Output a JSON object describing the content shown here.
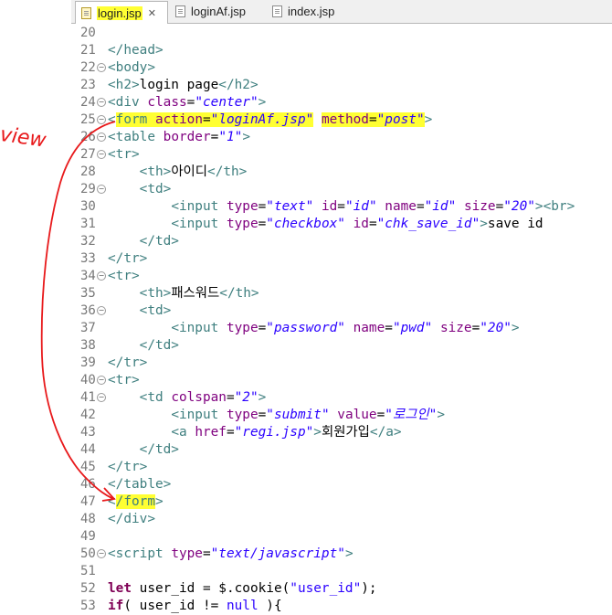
{
  "tabs": [
    {
      "label": "login.jsp",
      "active": true,
      "close": "✕"
    },
    {
      "label": "loginAf.jsp",
      "active": false
    },
    {
      "label": "index.jsp",
      "active": false
    }
  ],
  "annotation": {
    "text": "view",
    "color": "#e8191b"
  },
  "lines": [
    {
      "n": "20",
      "fold": false,
      "parts": []
    },
    {
      "n": "21",
      "fold": false,
      "parts": [
        [
          "tag",
          "</head>"
        ]
      ]
    },
    {
      "n": "22",
      "fold": true,
      "parts": [
        [
          "tag",
          "<body>"
        ]
      ]
    },
    {
      "n": "23",
      "fold": false,
      "parts": [
        [
          "tag",
          "<h2>"
        ],
        [
          "txt",
          "login page"
        ],
        [
          "tag",
          "</h2>"
        ]
      ]
    },
    {
      "n": "24",
      "fold": true,
      "parts": [
        [
          "tag",
          "<div "
        ],
        [
          "attr",
          "class"
        ],
        [
          "txt",
          "="
        ],
        [
          "val",
          "\"center\""
        ],
        [
          "tag",
          ">"
        ]
      ]
    },
    {
      "n": "25",
      "fold": true,
      "parts": [
        [
          "tag",
          "<"
        ],
        [
          "tagh",
          "form "
        ],
        [
          "attrh",
          "action"
        ],
        [
          "txth",
          "="
        ],
        [
          "valh",
          "\"loginAf.jsp\""
        ],
        [
          "txt",
          " "
        ],
        [
          "attrh",
          "method"
        ],
        [
          "txth",
          "="
        ],
        [
          "valh",
          "\"post\""
        ],
        [
          "tag",
          ">"
        ]
      ]
    },
    {
      "n": "26",
      "fold": true,
      "parts": [
        [
          "tag",
          "<table "
        ],
        [
          "attr",
          "border"
        ],
        [
          "txt",
          "="
        ],
        [
          "val",
          "\"1\""
        ],
        [
          "tag",
          ">"
        ]
      ]
    },
    {
      "n": "27",
      "fold": true,
      "parts": [
        [
          "tag",
          "<tr>"
        ]
      ]
    },
    {
      "n": "28",
      "fold": false,
      "parts": [
        [
          "txt",
          "    "
        ],
        [
          "tag",
          "<th>"
        ],
        [
          "txt",
          "아이디"
        ],
        [
          "tag",
          "</th>"
        ]
      ]
    },
    {
      "n": "29",
      "fold": true,
      "parts": [
        [
          "txt",
          "    "
        ],
        [
          "tag",
          "<td>"
        ]
      ]
    },
    {
      "n": "30",
      "fold": false,
      "parts": [
        [
          "txt",
          "        "
        ],
        [
          "tag",
          "<input "
        ],
        [
          "attr",
          "type"
        ],
        [
          "txt",
          "="
        ],
        [
          "val",
          "\"text\""
        ],
        [
          "txt",
          " "
        ],
        [
          "attr",
          "id"
        ],
        [
          "txt",
          "="
        ],
        [
          "val",
          "\"id\""
        ],
        [
          "txt",
          " "
        ],
        [
          "attr",
          "name"
        ],
        [
          "txt",
          "="
        ],
        [
          "val",
          "\"id\""
        ],
        [
          "txt",
          " "
        ],
        [
          "attr",
          "size"
        ],
        [
          "txt",
          "="
        ],
        [
          "val",
          "\"20\""
        ],
        [
          "tag",
          ">"
        ],
        [
          "tag",
          "<br>"
        ]
      ]
    },
    {
      "n": "31",
      "fold": false,
      "parts": [
        [
          "txt",
          "        "
        ],
        [
          "tag",
          "<input "
        ],
        [
          "attr",
          "type"
        ],
        [
          "txt",
          "="
        ],
        [
          "val",
          "\"checkbox\""
        ],
        [
          "txt",
          " "
        ],
        [
          "attr",
          "id"
        ],
        [
          "txt",
          "="
        ],
        [
          "val",
          "\"chk_save_id\""
        ],
        [
          "tag",
          ">"
        ],
        [
          "txt",
          "save id"
        ]
      ]
    },
    {
      "n": "32",
      "fold": false,
      "parts": [
        [
          "txt",
          "    "
        ],
        [
          "tag",
          "</td>"
        ]
      ]
    },
    {
      "n": "33",
      "fold": false,
      "parts": [
        [
          "tag",
          "</tr>"
        ]
      ]
    },
    {
      "n": "34",
      "fold": true,
      "parts": [
        [
          "tag",
          "<tr>"
        ]
      ]
    },
    {
      "n": "35",
      "fold": false,
      "parts": [
        [
          "txt",
          "    "
        ],
        [
          "tag",
          "<th>"
        ],
        [
          "txt",
          "패스워드"
        ],
        [
          "tag",
          "</th>"
        ]
      ]
    },
    {
      "n": "36",
      "fold": true,
      "parts": [
        [
          "txt",
          "    "
        ],
        [
          "tag",
          "<td>"
        ]
      ]
    },
    {
      "n": "37",
      "fold": false,
      "parts": [
        [
          "txt",
          "        "
        ],
        [
          "tag",
          "<input "
        ],
        [
          "attr",
          "type"
        ],
        [
          "txt",
          "="
        ],
        [
          "val",
          "\"password\""
        ],
        [
          "txt",
          " "
        ],
        [
          "attr",
          "name"
        ],
        [
          "txt",
          "="
        ],
        [
          "val",
          "\"pwd\""
        ],
        [
          "txt",
          " "
        ],
        [
          "attr",
          "size"
        ],
        [
          "txt",
          "="
        ],
        [
          "val",
          "\"20\""
        ],
        [
          "tag",
          ">"
        ]
      ]
    },
    {
      "n": "38",
      "fold": false,
      "parts": [
        [
          "txt",
          "    "
        ],
        [
          "tag",
          "</td>"
        ]
      ]
    },
    {
      "n": "39",
      "fold": false,
      "parts": [
        [
          "tag",
          "</tr>"
        ]
      ]
    },
    {
      "n": "40",
      "fold": true,
      "parts": [
        [
          "tag",
          "<tr>"
        ]
      ]
    },
    {
      "n": "41",
      "fold": true,
      "parts": [
        [
          "txt",
          "    "
        ],
        [
          "tag",
          "<td "
        ],
        [
          "attr",
          "colspan"
        ],
        [
          "txt",
          "="
        ],
        [
          "val",
          "\"2\""
        ],
        [
          "tag",
          ">"
        ]
      ]
    },
    {
      "n": "42",
      "fold": false,
      "parts": [
        [
          "txt",
          "        "
        ],
        [
          "tag",
          "<input "
        ],
        [
          "attr",
          "type"
        ],
        [
          "txt",
          "="
        ],
        [
          "val",
          "\"submit\""
        ],
        [
          "txt",
          " "
        ],
        [
          "attr",
          "value"
        ],
        [
          "txt",
          "="
        ],
        [
          "val",
          "\"로그인\""
        ],
        [
          "tag",
          ">"
        ]
      ]
    },
    {
      "n": "43",
      "fold": false,
      "parts": [
        [
          "txt",
          "        "
        ],
        [
          "tag",
          "<a "
        ],
        [
          "attr",
          "href"
        ],
        [
          "txt",
          "="
        ],
        [
          "val",
          "\"regi.jsp\""
        ],
        [
          "tag",
          ">"
        ],
        [
          "txt",
          "회원가입"
        ],
        [
          "tag",
          "</a>"
        ]
      ]
    },
    {
      "n": "44",
      "fold": false,
      "parts": [
        [
          "txt",
          "    "
        ],
        [
          "tag",
          "</td>"
        ]
      ]
    },
    {
      "n": "45",
      "fold": false,
      "parts": [
        [
          "tag",
          "</tr>"
        ]
      ]
    },
    {
      "n": "46",
      "fold": false,
      "parts": [
        [
          "tag",
          "</table>"
        ]
      ]
    },
    {
      "n": "47",
      "fold": false,
      "parts": [
        [
          "tag",
          "<"
        ],
        [
          "tagh",
          "/form"
        ],
        [
          "tag",
          ">"
        ]
      ]
    },
    {
      "n": "48",
      "fold": false,
      "parts": [
        [
          "tag",
          "</div>"
        ]
      ]
    },
    {
      "n": "49",
      "fold": false,
      "parts": []
    },
    {
      "n": "50",
      "fold": true,
      "parts": [
        [
          "tag",
          "<script "
        ],
        [
          "attr",
          "type"
        ],
        [
          "txt",
          "="
        ],
        [
          "val",
          "\"text/javascript\""
        ],
        [
          "tag",
          ">"
        ]
      ]
    },
    {
      "n": "51",
      "fold": false,
      "parts": []
    },
    {
      "n": "52",
      "fold": false,
      "parts": [
        [
          "kw",
          "let"
        ],
        [
          "txt",
          " user_id = $.cookie("
        ],
        [
          "str",
          "\"user_id\""
        ],
        [
          "txt",
          ");"
        ]
      ]
    },
    {
      "n": "53",
      "fold": false,
      "parts": [
        [
          "kw",
          "if"
        ],
        [
          "txt",
          "( user_id != "
        ],
        [
          "str",
          "null"
        ],
        [
          "txt",
          " ){"
        ]
      ]
    }
  ]
}
